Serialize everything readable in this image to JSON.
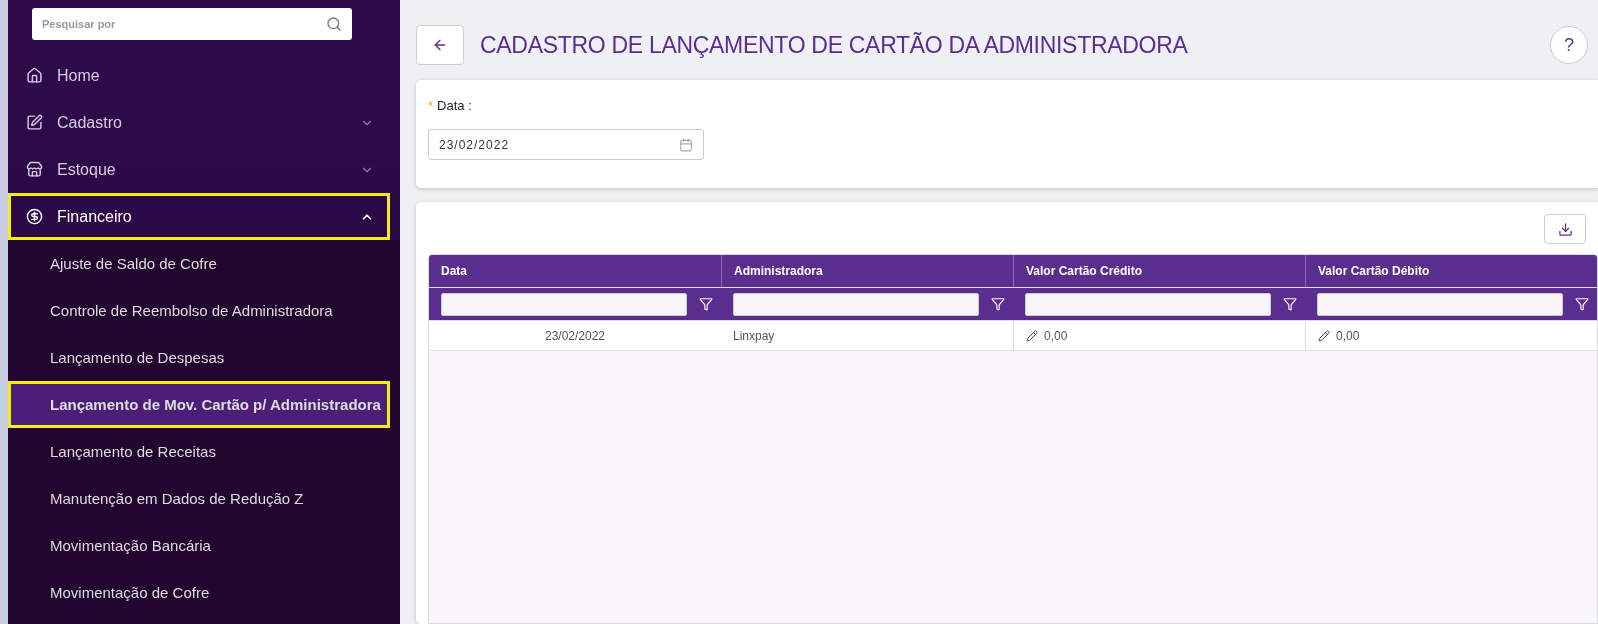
{
  "sidebar": {
    "search": {
      "placeholder": "Pesquisar por"
    },
    "items": [
      {
        "label": "Home",
        "highlighted": false
      },
      {
        "label": "Cadastro",
        "expanded": false,
        "highlighted": false
      },
      {
        "label": "Estoque",
        "expanded": false,
        "highlighted": false
      },
      {
        "label": "Financeiro",
        "expanded": true,
        "highlighted": true,
        "children": [
          {
            "label": "Ajuste de Saldo de Cofre",
            "selected": false
          },
          {
            "label": "Controle de Reembolso de Administradora",
            "selected": false
          },
          {
            "label": "Lançamento de Despesas",
            "selected": false
          },
          {
            "label": "Lançamento de Mov. Cartão p/ Administradora",
            "selected": true
          },
          {
            "label": "Lançamento de Receitas",
            "selected": false
          },
          {
            "label": "Manutenção em Dados de Redução Z",
            "selected": false
          },
          {
            "label": "Movimentação Bancária",
            "selected": false
          },
          {
            "label": "Movimentação de Cofre",
            "selected": false
          }
        ]
      }
    ]
  },
  "page": {
    "title": "CADASTRO DE LANÇAMENTO DE CARTÃO DA ADMINISTRADORA",
    "help": "?"
  },
  "form": {
    "required_mark": "*",
    "label": "Data",
    "colon": ":",
    "value": "23/02/2022"
  },
  "table": {
    "columns": [
      "Data",
      "Administradora",
      "Valor Cartão Crédito",
      "Valor Cartão Débito"
    ],
    "rows": [
      {
        "data": "23/02/2022",
        "administradora": "Linxpay",
        "credito": "0,00",
        "debito": "0,00"
      }
    ]
  }
}
